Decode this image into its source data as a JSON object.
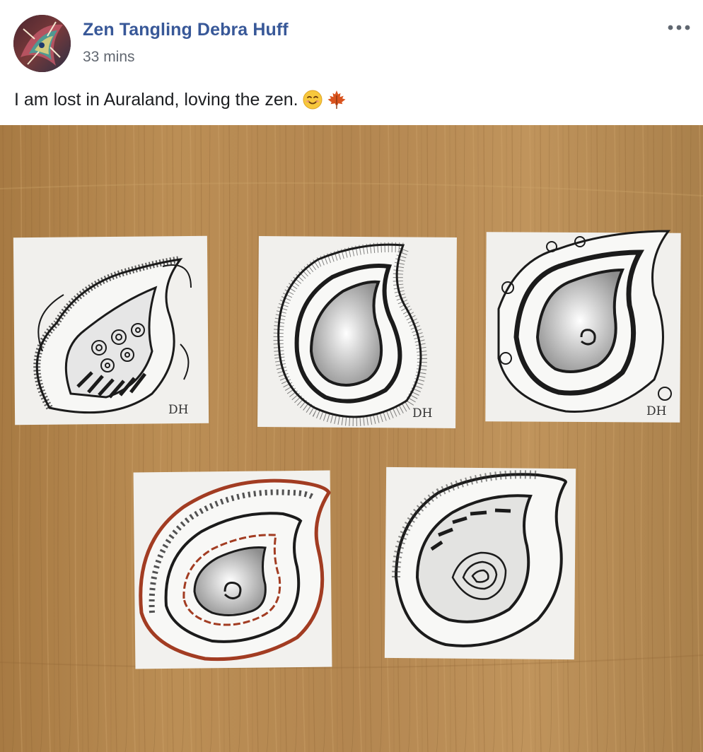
{
  "post": {
    "author_name": "Zen Tangling Debra Huff",
    "timestamp": "33 mins",
    "caption": "I am lost in Auraland, loving the zen.",
    "emojis": [
      "smiling-face-icon",
      "maple-leaf-icon"
    ],
    "more_icon": "more-options-icon"
  },
  "colors": {
    "author_link": "#385898",
    "timestamp": "#616770",
    "text": "#1c1e21",
    "wood": "#b68a52",
    "wood_dark": "#8e6533",
    "paper": "#f2f1ee",
    "ink": "#1b1b1b",
    "red_ink": "#a23c22"
  },
  "photo": {
    "signature": "DH"
  }
}
